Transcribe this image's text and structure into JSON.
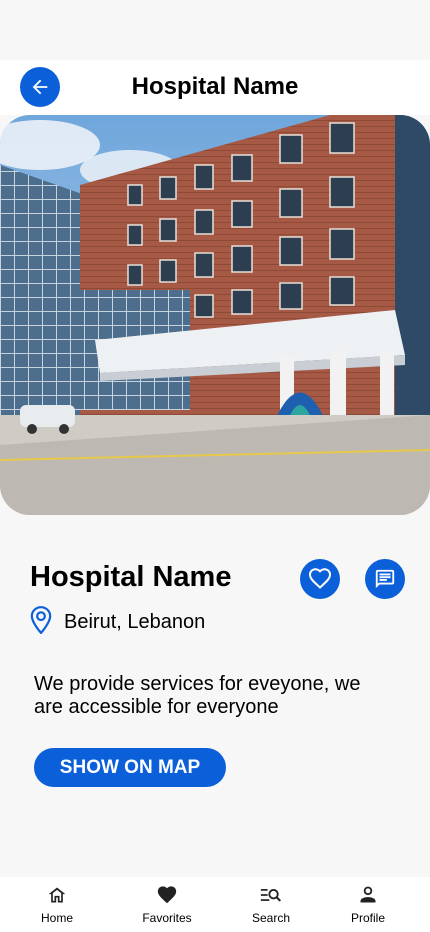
{
  "header": {
    "title": "Hospital Name",
    "back_icon": "arrow-left-icon"
  },
  "hero": {
    "image": "hospital-building-photo"
  },
  "hospital": {
    "name": "Hospital Name",
    "location": "Beirut, Lebanon",
    "description": "We provide services for eveyone, we are accessible for everyone",
    "map_button": "SHOW ON MAP"
  },
  "nav": {
    "items": [
      {
        "label": "Home",
        "icon": "home-icon"
      },
      {
        "label": "Favorites",
        "icon": "heart-icon"
      },
      {
        "label": "Search",
        "icon": "search-icon"
      },
      {
        "label": "Profile",
        "icon": "person-icon"
      }
    ]
  },
  "colors": {
    "accent": "#0b5fd9",
    "background": "#f7f7f7"
  }
}
